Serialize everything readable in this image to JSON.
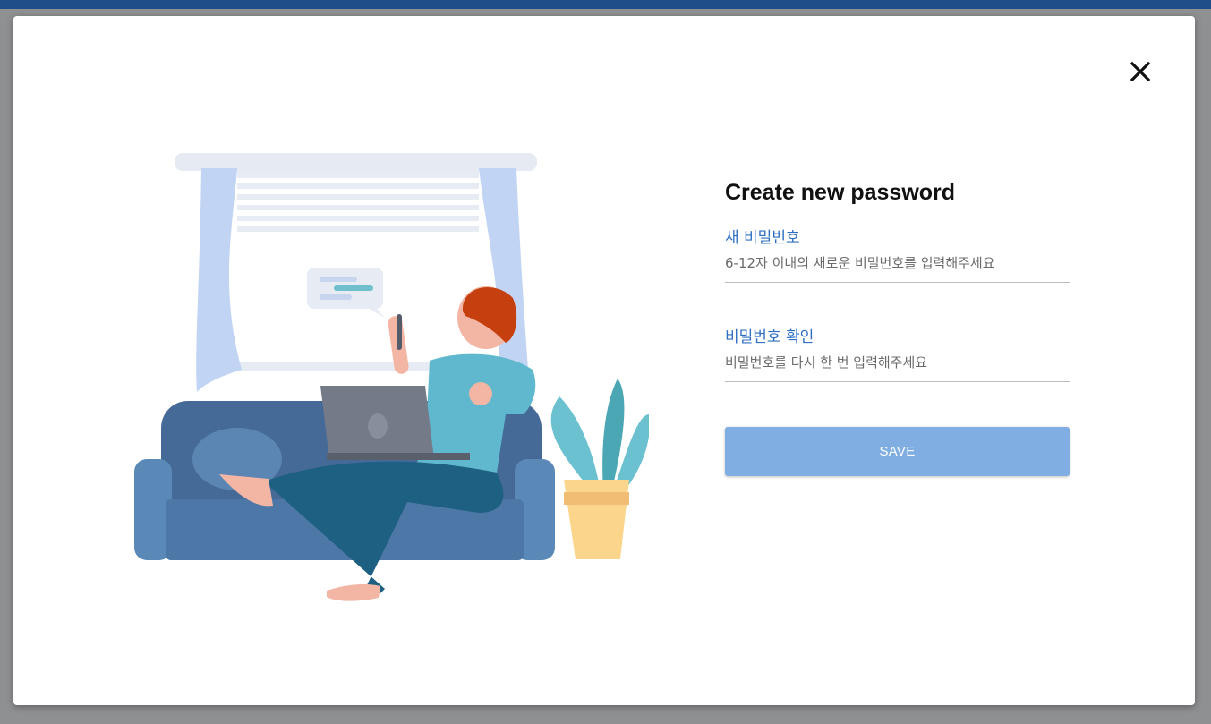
{
  "dialog": {
    "title": "Create new password",
    "close_icon": "close-icon",
    "illustration": "person-on-sofa-with-laptop-illustration"
  },
  "fields": {
    "new_password": {
      "label": "새 비밀번호",
      "value": "",
      "placeholder": "6-12자 이내의 새로운 비밀번호를 입력해주세요"
    },
    "confirm_password": {
      "label": "비밀번호 확인",
      "value": "",
      "placeholder": "비밀번호를 다시 한 번 입력해주세요"
    }
  },
  "actions": {
    "save_label": "SAVE"
  },
  "colors": {
    "top_bar": "#1f4e88",
    "overlay": "#8f9092",
    "label_blue": "#2f6fc2",
    "save_button": "#80aee2"
  }
}
